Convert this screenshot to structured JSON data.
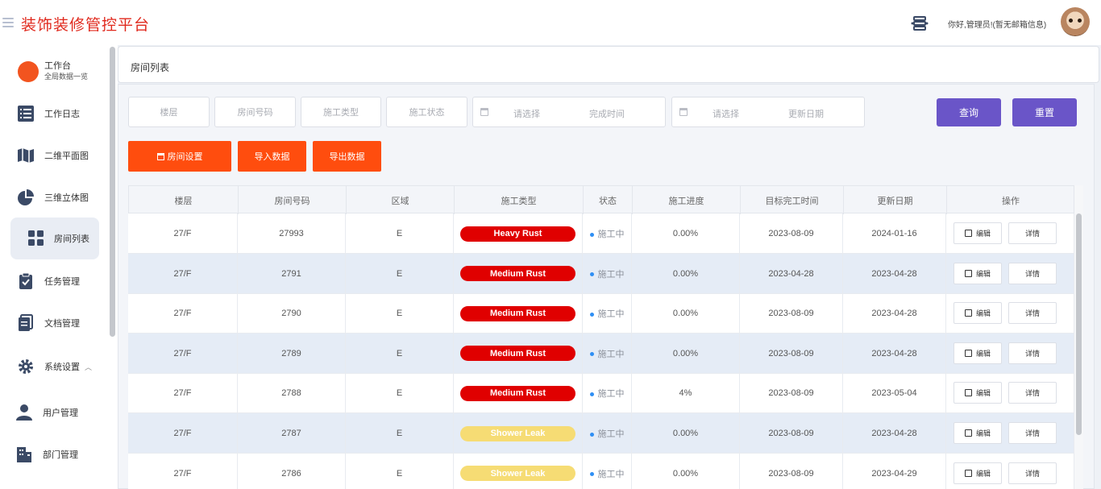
{
  "header": {
    "title": "装饰装修管控平台",
    "greeting": "你好,管理员!(暂无邮箱信息)"
  },
  "sidebar": {
    "workspace": {
      "label": "工作台",
      "sub": "全局数据一览"
    },
    "items": [
      {
        "label": "工作日志",
        "icon": "list-icon"
      },
      {
        "label": "二维平面图",
        "icon": "map-icon"
      },
      {
        "label": "三维立体图",
        "icon": "pie-chart-icon"
      },
      {
        "label": "房间列表",
        "icon": "grid-icon",
        "active": true
      },
      {
        "label": "任务管理",
        "icon": "clipboard-icon"
      },
      {
        "label": "文档管理",
        "icon": "document-icon"
      },
      {
        "label": "系统设置",
        "icon": "gear-icon"
      },
      {
        "label": "用户管理",
        "icon": "user-icon"
      },
      {
        "label": "部门管理",
        "icon": "building-icon"
      }
    ]
  },
  "breadcrumb": "房间列表",
  "filters": {
    "floor": "楼层",
    "room_no": "房间号码",
    "construction_type": "施工类型",
    "construction_status": "施工状态",
    "complete_time_placeholder": "请选择",
    "complete_time_label": "完成时间",
    "update_date_placeholder": "请选择",
    "update_date_label": "更新日期",
    "query": "查询",
    "reset": "重置"
  },
  "actions": {
    "room_settings": "房间设置",
    "import": "导入数据",
    "export": "导出数据"
  },
  "table": {
    "columns": [
      "楼层",
      "房间号码",
      "区域",
      "施工类型",
      "状态",
      "施工进度",
      "目标完工时间",
      "更新日期",
      "操作"
    ],
    "edit_label": "编辑",
    "detail_label": "详情",
    "tag_colors": {
      "Heavy Rust": "#e00000",
      "Medium Rust": "#e00000",
      "Shower Leak": "#f6dc74"
    },
    "rows": [
      {
        "floor": "27/F",
        "room": "27993",
        "area": "E",
        "type": "Heavy Rust",
        "status": "施工中",
        "progress": "0.00%",
        "target": "2023-08-09",
        "updated": "2024-01-16"
      },
      {
        "floor": "27/F",
        "room": "2791",
        "area": "E",
        "type": "Medium Rust",
        "status": "施工中",
        "progress": "0.00%",
        "target": "2023-04-28",
        "updated": "2023-04-28"
      },
      {
        "floor": "27/F",
        "room": "2790",
        "area": "E",
        "type": "Medium Rust",
        "status": "施工中",
        "progress": "0.00%",
        "target": "2023-08-09",
        "updated": "2023-04-28"
      },
      {
        "floor": "27/F",
        "room": "2789",
        "area": "E",
        "type": "Medium Rust",
        "status": "施工中",
        "progress": "0.00%",
        "target": "2023-08-09",
        "updated": "2023-04-28"
      },
      {
        "floor": "27/F",
        "room": "2788",
        "area": "E",
        "type": "Medium Rust",
        "status": "施工中",
        "progress": "4%",
        "target": "2023-08-09",
        "updated": "2023-05-04"
      },
      {
        "floor": "27/F",
        "room": "2787",
        "area": "E",
        "type": "Shower Leak",
        "status": "施工中",
        "progress": "0.00%",
        "target": "2023-08-09",
        "updated": "2023-04-28"
      },
      {
        "floor": "27/F",
        "room": "2786",
        "area": "E",
        "type": "Shower Leak",
        "status": "施工中",
        "progress": "0.00%",
        "target": "2023-08-09",
        "updated": "2023-04-29"
      }
    ]
  }
}
